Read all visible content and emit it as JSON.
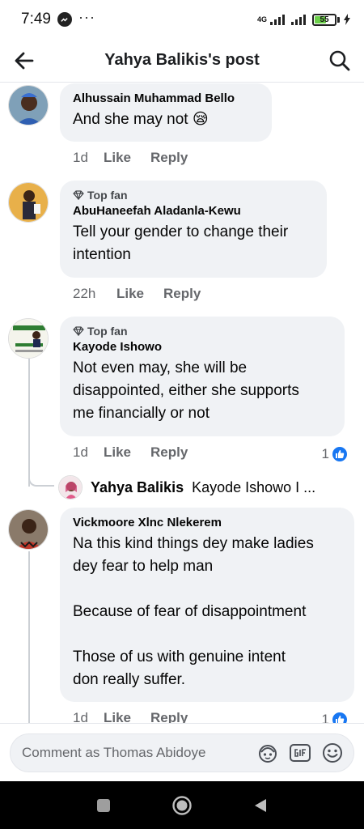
{
  "status": {
    "time": "7:49",
    "network": "4G",
    "battery": "55",
    "battery_level": 0.55
  },
  "header": {
    "title": "Yahya Balikis's post"
  },
  "comments": [
    {
      "author": "Alhussain Muhammad Bello",
      "text": "And she may not 😪",
      "time": "1d",
      "like": "Like",
      "reply": "Reply",
      "top_fan": ""
    },
    {
      "author": "AbuHaneefah Aladanla-Kewu",
      "text": "Tell your gender to change their\nintention",
      "time": "22h",
      "like": "Like",
      "reply": "Reply",
      "top_fan": "Top fan"
    },
    {
      "author": "Kayode Ishowo",
      "text": "Not even may,  she will be\ndisappointed,  either she supports\nme financially or not",
      "time": "1d",
      "like": "Like",
      "reply": "Reply",
      "top_fan": "Top fan",
      "reactions": "1"
    },
    {
      "author": "Vickmoore Xlnc Nlekerem",
      "text": "Na this kind things dey make ladies\ndey fear to help man\n\nBecause of fear of disappointment\n\nThose of us with genuine intent\ndon really suffer.",
      "time": "1d",
      "like": "Like",
      "reply": "Reply",
      "top_fan": "",
      "reactions": "1"
    }
  ],
  "reply_preview": {
    "author": "Yahya Balikis",
    "snippet": "Kayode Ishowo I ..."
  },
  "composer": {
    "placeholder": "Comment as Thomas Abidoye"
  },
  "colors": {
    "accent": "#1877f2",
    "bubble": "#f0f2f5",
    "meta": "#65676b"
  },
  "icons": [
    "back-arrow-icon",
    "search-icon",
    "diamond-icon",
    "like-thumb-icon",
    "avatar-sticker-icon",
    "gif-icon",
    "emoji-icon",
    "square-icon",
    "circle-icon",
    "triangle-back-icon",
    "messenger-icon"
  ]
}
